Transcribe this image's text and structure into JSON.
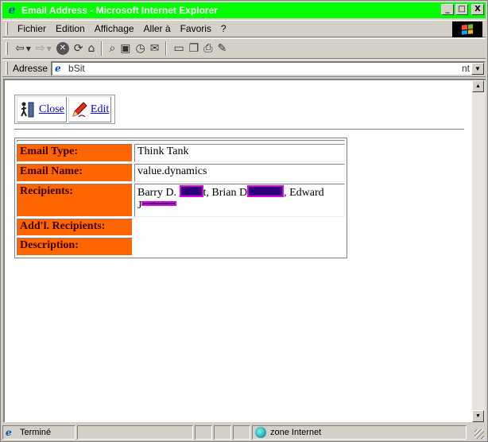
{
  "window": {
    "title": "Email Address - Microsoft Internet Explorer",
    "minimize": "_",
    "maximize": "□",
    "close": "X"
  },
  "menu": {
    "items": [
      {
        "label": "Fichier"
      },
      {
        "label": "Edition"
      },
      {
        "label": "Affichage"
      },
      {
        "label": "Aller à"
      },
      {
        "label": "Favoris"
      },
      {
        "label": "?"
      }
    ]
  },
  "toolbar": {
    "icons": [
      "back-icon",
      "forward-icon",
      "stop-icon",
      "refresh-icon",
      "home-icon",
      "search-icon",
      "favorites-icon",
      "history-icon",
      "mail-icon",
      "fullscreen-icon",
      "folders-icon",
      "print-icon",
      "edit-icon"
    ]
  },
  "address": {
    "label": "Adresse",
    "value": "bSit",
    "tail": "nt"
  },
  "page": {
    "close_label": "Close",
    "edit_label": "Edit",
    "fields": [
      {
        "label": "Email Type:",
        "value": "Think Tank"
      },
      {
        "label": "Email Name:",
        "value": "value.dynamics"
      },
      {
        "label": "Recipients:",
        "value_parts": [
          "Barry D. ",
          "t, Brian D",
          ", Edward",
          "J"
        ]
      },
      {
        "label": "Add'l. Recipients:",
        "value": ""
      },
      {
        "label": "Description:",
        "value": ""
      }
    ]
  },
  "status": {
    "text": "Terminé",
    "zone": "zone Internet"
  },
  "colors": {
    "titlebar": "#00ff00",
    "label_bg": "#ff6600",
    "link": "#0000ee",
    "redaction_fill": "#2b007a",
    "redaction_border": "#e000e0"
  }
}
